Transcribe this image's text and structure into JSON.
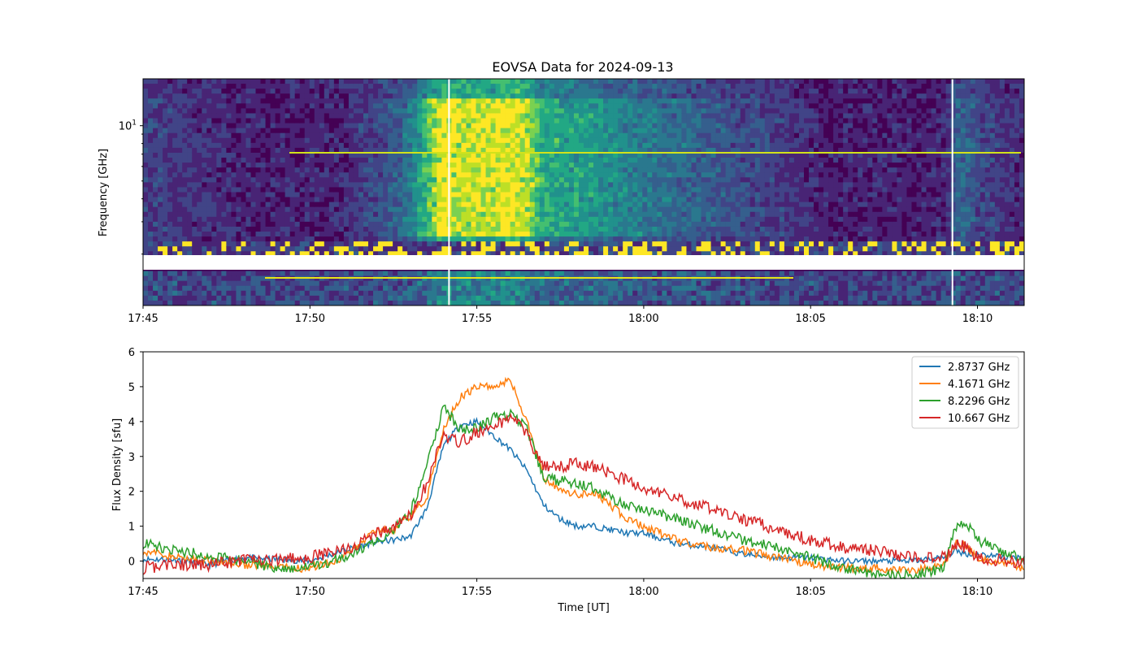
{
  "figure": {
    "title": "EOVSA Data for 2024-09-13"
  },
  "chart_data": [
    {
      "type": "heatmap",
      "title": "EOVSA Data for 2024-09-13",
      "xlabel": "",
      "ylabel": "Frequency [GHz]",
      "x_ticks": [
        "17:45",
        "17:50",
        "17:55",
        "18:00",
        "18:05",
        "18:10"
      ],
      "x_range": [
        "17:45",
        "18:11:24"
      ],
      "y_scale": "log",
      "y_ticks": [
        "10^1"
      ],
      "y_range": [
        1.05,
        18.0
      ],
      "colormap": "viridis",
      "description_features": {
        "burst_window": [
          "17:51",
          "17:58"
        ],
        "peak_time": "17:55",
        "secondary_burst": "18:09",
        "data_gaps": [
          "17:54:10",
          "18:09:15"
        ]
      }
    },
    {
      "type": "line",
      "title": "",
      "xlabel": "Time [UT]",
      "ylabel": "Flux Density [sfu]",
      "x_ticks": [
        "17:45",
        "17:50",
        "17:55",
        "18:00",
        "18:05",
        "18:10"
      ],
      "y_ticks": [
        "0",
        "1",
        "2",
        "3",
        "4",
        "5",
        "6"
      ],
      "x_range": [
        "17:45",
        "18:11:24"
      ],
      "ylim": [
        -0.5,
        6
      ],
      "legend_position": "top-right",
      "x": [
        "17:45",
        "17:46",
        "17:47",
        "17:48",
        "17:49",
        "17:50",
        "17:51",
        "17:52",
        "17:52:30",
        "17:53",
        "17:53:30",
        "17:54",
        "17:54:30",
        "17:55",
        "17:55:30",
        "17:56",
        "17:56:30",
        "17:57",
        "17:57:30",
        "17:58",
        "17:58:30",
        "17:59",
        "17:59:30",
        "18:00",
        "18:01",
        "18:02",
        "18:03",
        "18:04",
        "18:05",
        "18:06",
        "18:07",
        "18:08",
        "18:09",
        "18:09:20",
        "18:09:40",
        "18:10",
        "18:11",
        "18:11:24"
      ],
      "series": [
        {
          "name": "2.8737 GHz",
          "color": "#1f77b4",
          "values": [
            0.05,
            0.05,
            -0.1,
            0.1,
            0.05,
            0.0,
            0.3,
            0.55,
            0.6,
            0.7,
            1.5,
            3.3,
            3.9,
            4.0,
            3.6,
            3.2,
            2.6,
            1.6,
            1.2,
            1.0,
            1.0,
            0.9,
            0.8,
            0.8,
            0.5,
            0.4,
            0.2,
            0.1,
            0.1,
            0.0,
            0.0,
            0.0,
            0.1,
            0.3,
            0.2,
            0.2,
            0.1,
            0.1
          ]
        },
        {
          "name": "4.1671 GHz",
          "color": "#ff7f0e",
          "values": [
            0.3,
            0.1,
            0.0,
            -0.1,
            -0.2,
            -0.2,
            0.1,
            0.9,
            0.9,
            1.3,
            1.8,
            3.8,
            4.7,
            5.0,
            5.0,
            5.2,
            4.0,
            2.4,
            2.0,
            1.9,
            2.0,
            1.6,
            1.2,
            1.0,
            0.6,
            0.4,
            0.3,
            0.1,
            -0.1,
            -0.2,
            -0.2,
            -0.3,
            -0.1,
            0.5,
            0.4,
            0.1,
            -0.1,
            -0.2
          ]
        },
        {
          "name": "8.2296 GHz",
          "color": "#2ca02c",
          "values": [
            0.5,
            0.3,
            0.15,
            0.0,
            -0.2,
            -0.2,
            0.1,
            0.6,
            0.9,
            1.4,
            2.7,
            4.4,
            3.8,
            3.8,
            4.1,
            4.2,
            3.8,
            2.4,
            2.3,
            2.2,
            2.1,
            1.8,
            1.6,
            1.5,
            1.2,
            0.9,
            0.6,
            0.4,
            0.1,
            -0.2,
            -0.4,
            -0.4,
            -0.2,
            1.0,
            1.1,
            0.6,
            0.2,
            0.0
          ]
        },
        {
          "name": "10.667 GHz",
          "color": "#d62728",
          "values": [
            -0.2,
            -0.1,
            -0.1,
            0.0,
            0.05,
            0.1,
            0.3,
            0.8,
            1.0,
            1.3,
            2.2,
            3.6,
            3.4,
            3.7,
            3.8,
            4.2,
            3.6,
            2.7,
            2.7,
            2.8,
            2.7,
            2.5,
            2.3,
            2.1,
            1.8,
            1.5,
            1.2,
            0.9,
            0.6,
            0.4,
            0.3,
            0.1,
            0.1,
            0.5,
            0.4,
            0.1,
            0.0,
            -0.1
          ]
        }
      ]
    }
  ]
}
